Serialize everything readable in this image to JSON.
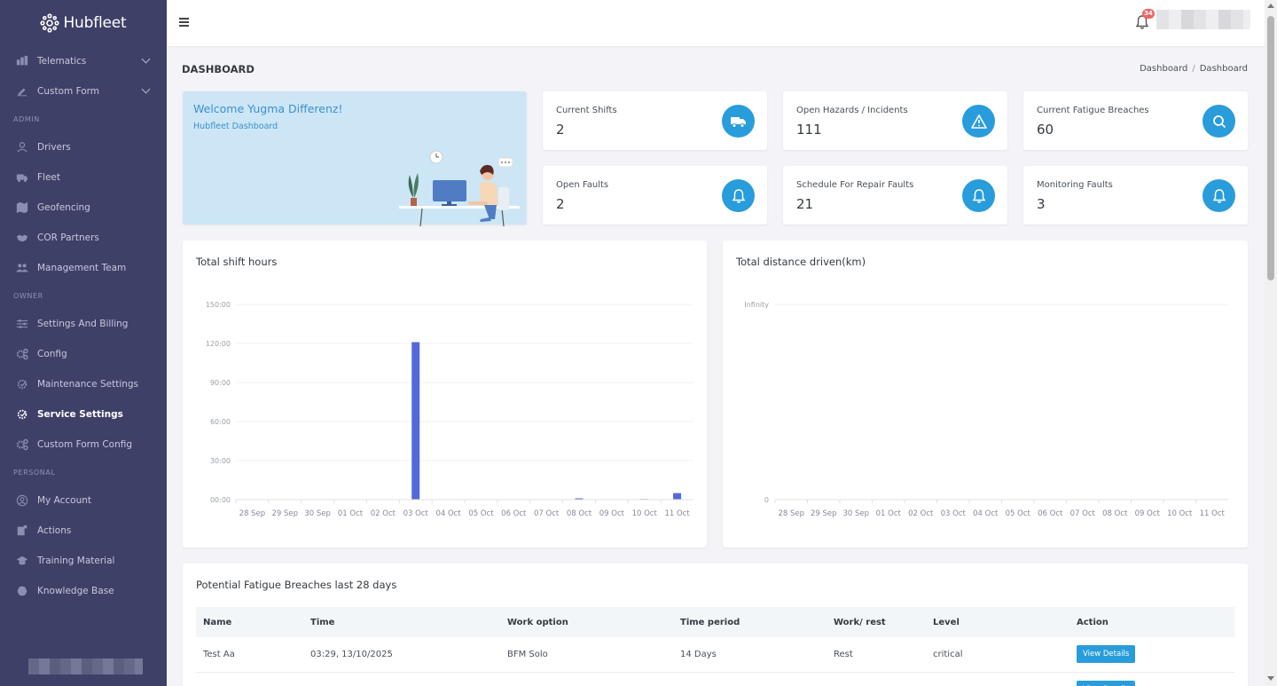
{
  "brand": {
    "name": "Hubfleet"
  },
  "sidebar": {
    "items": [
      {
        "label": "Telematics",
        "icon": "telematics-icon",
        "expandable": true
      },
      {
        "label": "Custom Form",
        "icon": "custom-form-icon",
        "expandable": true
      }
    ],
    "sections": [
      {
        "title": "ADMIN",
        "items": [
          {
            "label": "Drivers",
            "icon": "user-icon"
          },
          {
            "label": "Fleet",
            "icon": "truck-icon"
          },
          {
            "label": "Geofencing",
            "icon": "map-icon"
          },
          {
            "label": "COR Partners",
            "icon": "handshake-icon"
          },
          {
            "label": "Management Team",
            "icon": "users-icon"
          }
        ]
      },
      {
        "title": "OWNER",
        "items": [
          {
            "label": "Settings And Billing",
            "icon": "sliders-icon"
          },
          {
            "label": "Config",
            "icon": "gears-icon"
          },
          {
            "label": "Maintenance Settings",
            "icon": "maintenance-icon"
          },
          {
            "label": "Service Settings",
            "icon": "service-icon",
            "active": true
          },
          {
            "label": "Custom Form Config",
            "icon": "gears-icon"
          }
        ]
      },
      {
        "title": "PERSONAL",
        "items": [
          {
            "label": "My Account",
            "icon": "account-icon"
          },
          {
            "label": "Actions",
            "icon": "actions-icon"
          },
          {
            "label": "Training Material",
            "icon": "graduation-icon"
          },
          {
            "label": "Knowledge Base",
            "icon": "brain-icon"
          }
        ]
      }
    ]
  },
  "topbar": {
    "notifications_count": "34"
  },
  "page": {
    "title": "DASHBOARD",
    "breadcrumb": [
      "Dashboard",
      "Dashboard"
    ]
  },
  "welcome": {
    "title": "Welcome Yugma Differenz!",
    "subtitle": "Hubfleet Dashboard"
  },
  "stats": [
    {
      "label": "Current Shifts",
      "value": "2",
      "icon": "truck-icon"
    },
    {
      "label": "Open Hazards / Incidents",
      "value": "111",
      "icon": "warning-icon"
    },
    {
      "label": "Current Fatigue Breaches",
      "value": "60",
      "icon": "search-icon"
    },
    {
      "label": "Open Faults",
      "value": "2",
      "icon": "bell-icon"
    },
    {
      "label": "Schedule For Repair Faults",
      "value": "21",
      "icon": "bell-icon"
    },
    {
      "label": "Monitoring Faults",
      "value": "3",
      "icon": "bell-icon"
    }
  ],
  "colors": {
    "accent": "#299cdb",
    "bar": "#5468da",
    "sidebar": "#3e4068"
  },
  "chart_data": [
    {
      "type": "bar",
      "title": "Total shift hours",
      "categories": [
        "28 Sep",
        "29 Sep",
        "30 Sep",
        "01 Oct",
        "02 Oct",
        "03 Oct",
        "04 Oct",
        "05 Oct",
        "06 Oct",
        "07 Oct",
        "08 Oct",
        "09 Oct",
        "10 Oct",
        "11 Oct"
      ],
      "values": [
        0,
        0,
        0,
        0,
        0,
        121,
        0,
        0,
        0,
        0,
        1,
        0,
        0.5,
        5
      ],
      "yticks": [
        "00:00",
        "30:00",
        "60:00",
        "90:00",
        "120:00",
        "150:00"
      ],
      "ylim": [
        0,
        150
      ],
      "grid": true
    },
    {
      "type": "bar",
      "title": "Total distance driven(km)",
      "categories": [
        "28 Sep",
        "29 Sep",
        "30 Sep",
        "01 Oct",
        "02 Oct",
        "03 Oct",
        "04 Oct",
        "05 Oct",
        "06 Oct",
        "07 Oct",
        "08 Oct",
        "09 Oct",
        "10 Oct",
        "11 Oct"
      ],
      "values": [
        0,
        0,
        0,
        0,
        0,
        0,
        0,
        0,
        0,
        0,
        0,
        0,
        0,
        0
      ],
      "yticks": [
        "0",
        "Infinity"
      ],
      "grid": true
    }
  ],
  "fatigue_table": {
    "title": "Potential Fatigue Breaches last 28 days",
    "columns": [
      "Name",
      "Time",
      "Work option",
      "Time period",
      "Work/ rest",
      "Level",
      "Action"
    ],
    "rows": [
      {
        "name": "Test Aa",
        "time": "03:29, 13/10/2025",
        "work_option": "BFM Solo",
        "time_period": "14 Days",
        "work_rest": "Rest",
        "level": "critical",
        "action": "View Details"
      },
      {
        "name": "",
        "time": "",
        "work_option": "",
        "time_period": "",
        "work_rest": "",
        "level": "",
        "action": "View Details"
      }
    ]
  }
}
